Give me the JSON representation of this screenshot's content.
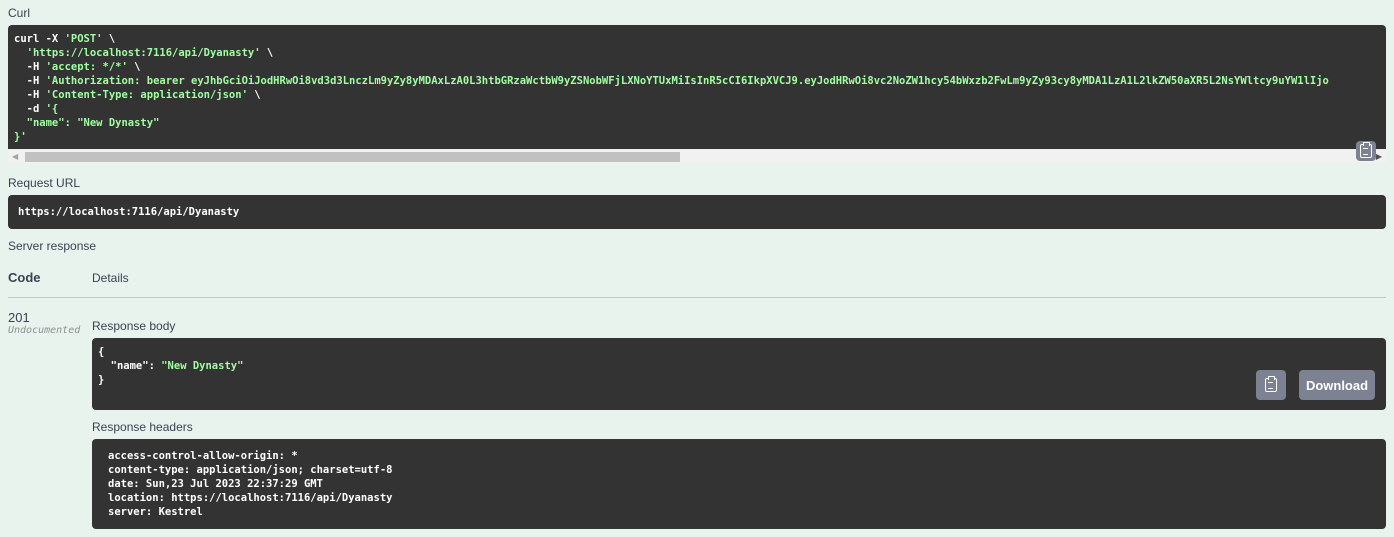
{
  "curl": {
    "label": "Curl",
    "line1_cmd": "curl -X ",
    "line1_method": "'POST'",
    "line1_end": " \\",
    "line2_url": "  'https://localhost:7116/api/Dyanasty'",
    "line2_end": " \\",
    "line3_flag": "  -H ",
    "line3_val": "'accept: */*'",
    "line3_end": " \\",
    "line4_flag": "  -H ",
    "line4_val": "'Authorization: bearer eyJhbGciOiJodHRwOi8vd3d3LnczLm9yZy8yMDAxLzA0L3htbGRzaWctbW9yZSNobWFjLXNoYTUxMiIsInR5cCI6IkpXVCJ9.eyJodHRwOi8vc2NoZW1hcy54bWxzb2FwLm9yZy93cy8yMDA1LzA1L2lkZW50aXR5L2NsYWltcy9uYW1lIjo",
    "line5_flag": "  -H ",
    "line5_val": "'Content-Type: application/json'",
    "line5_end": " \\",
    "line6_flag": "  -d ",
    "line6_val": "'{",
    "line7": "  \"name\": \"New Dynasty\"",
    "line8": "}'"
  },
  "request_url": {
    "label": "Request URL",
    "value": "https://localhost:7116/api/Dyanasty"
  },
  "server_response": {
    "label": "Server response",
    "col_code": "Code",
    "col_details": "Details",
    "status_code": "201",
    "status_note": "Undocumented"
  },
  "response_body": {
    "label": "Response body",
    "open": "{",
    "key": "  \"name\"",
    "colon": ": ",
    "value": "\"New Dynasty\"",
    "close": "}",
    "download_label": "Download"
  },
  "response_headers": {
    "label": "Response headers",
    "lines": [
      "access-control-allow-origin: *",
      "content-type: application/json; charset=utf-8",
      "date: Sun,23 Jul 2023 22:37:29 GMT",
      "location: https://localhost:7116/api/Dyanasty",
      "server: Kestrel"
    ]
  },
  "icons": {
    "copy": "clipboard-copy-icon",
    "scroll_left": "scroll-left-arrow-icon",
    "scroll_right": "scroll-right-arrow-icon"
  },
  "colors": {
    "background": "#e8f3ee",
    "code_bg": "#333333",
    "string": "#a2fca2",
    "button": "#7d8293"
  }
}
